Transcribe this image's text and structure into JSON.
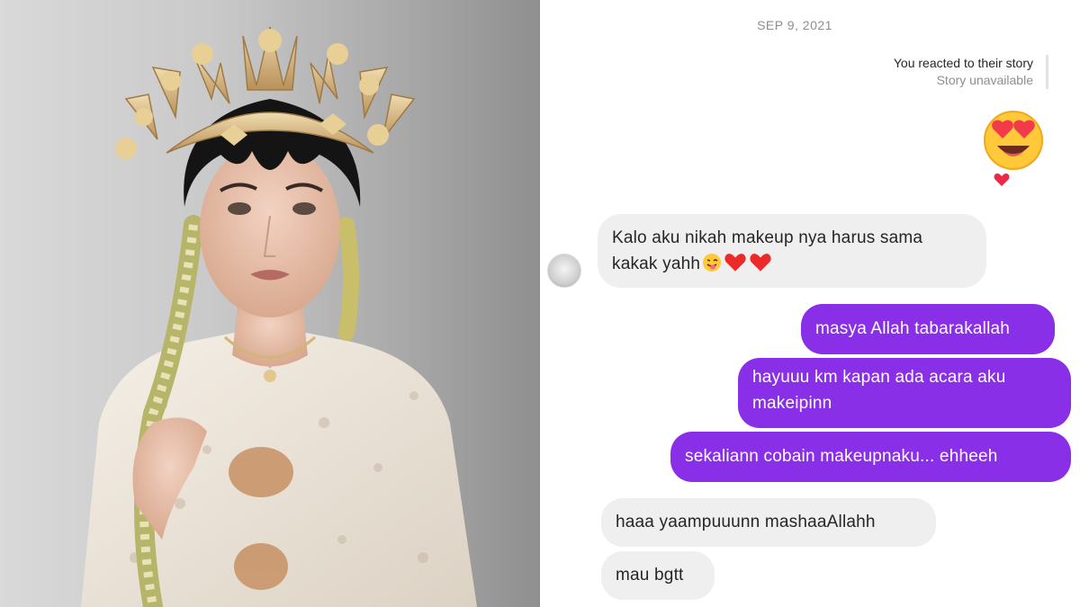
{
  "photo": {
    "description_icon": "bride-portrait-photo"
  },
  "chat": {
    "date": "SEP 9, 2021",
    "story_reply": {
      "line1": "You reacted to their story",
      "line2": "Story unavailable"
    },
    "reaction_emoji": "heart-eyes-emoji",
    "reaction_badge": "red-heart",
    "messages": [
      {
        "side": "in",
        "line1": "Kalo aku nikah makeup nya harus sama",
        "line2": "kakak yahh"
      },
      {
        "side": "out",
        "text": "masya Allah tabarakallah"
      },
      {
        "side": "out",
        "line1": "hayuuu km kapan ada acara aku",
        "line2": "makeipinn"
      },
      {
        "side": "out",
        "text": "sekaliann cobain makeupnaku... ehheeh"
      },
      {
        "side": "in",
        "text": "haaa yaampuuunn mashaaAllahh"
      },
      {
        "side": "in",
        "text": "mau bgtt"
      }
    ],
    "colors": {
      "outgoing": "#8a2fe8",
      "incoming": "#efefef",
      "date": "#8e8e8e"
    }
  }
}
